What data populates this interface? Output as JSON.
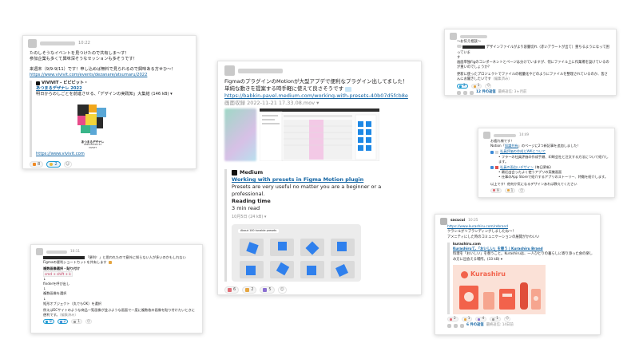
{
  "c1": {
    "time": "10:22",
    "line1": "たのしそうなイベントを見つけたので共有しま〜す！",
    "line2": "参加企業も多くて興味深そうなセッションも多そうです！",
    "line3": "来週末（9/9-9/11）です！申し込めば無料で見られるので興味ある方せひ〜！",
    "url": "https://www.vivivit.com/events/dezanare/atsumaru/2022",
    "unfurl_site": "VIVIVIT - ビビビット・",
    "unfurl_title": "あつまるデザナレ 2022",
    "unfurl_desc": "明日からのしごとを前進させる、「デザインの実践知」大集結 (146 kB) ▾",
    "poster_title": "あつまるデザナレ",
    "poster_date": "2022.09.09-11",
    "poster_brand": "VIVIVIT",
    "unfurl_link": "https://www.vivivit.com",
    "react_a": "8",
    "react_b": "2"
  },
  "c2": {
    "line1": "FigmaのプラグインのMotionが大型アプデで便利なプラグイン出してました！",
    "line2": "単純な動きを提案する時手軽に使えて良さそうです",
    "url": "https://babkin-pavel.medium.com/working-with-presets-40b07d5fcb8e",
    "file": "画面収録 2022-11-21 17.33.08.mov ▾",
    "medium_label": "Medium",
    "article_title": "Working with presets in Figma Motion plugin",
    "article_desc": "Presets are very useful no matter you are a beginner or a professional.",
    "read_label": "Reading time",
    "read_value": "3 min read",
    "date_meta": "10月5日 (24 kB) ▾",
    "preview_label": "About 100 tunable presets",
    "react_a": "6",
    "react_b": "2",
    "react_c": "5"
  },
  "c3": {
    "line1": "〜お伝え相談〜",
    "line2": "デザインファイルがより容量切れ（赤いアラートが出て）重ちるようになって困っていま",
    "line2b": "す",
    "line3": "画面単独Figのコンポーネントとページは分けていますが、何にファイル上に作業場を設けているのが重いのでしょうか？",
    "line4": "更新に使ったプロジェクトでファイルの軽量化やどのようにファイルを整理されているのか、皆さんにお聞きしたいです",
    "edited": "（編集済み）",
    "react_a": "2",
    "react_b": "1",
    "thread": "12 件の返信",
    "thread_time": "最終返信: 3ヶ月前"
  },
  "c4": {
    "time": "14:49",
    "line1": "お疲れ様です！",
    "line2a": "Notion「",
    "line2link": "知識共有",
    "line2b": "」のページに2つ新記事を追加しました！",
    "item1_link": "社員評価の作成とWKについて",
    "item1_sub": "フラーの社員評価の作成手順、印刷会社と注文する方法について紹介します。",
    "item2_link": "社員の面白いデザイン",
    "item2_tag": "(毎日更新)",
    "item2_sub1": "最近出会ったよく使うアプリの実機画面",
    "item2_sub2": "仕事のApp Storeで紹介するアプリのストーリー、特徴を紹介します。",
    "closing": "以上です！他何か気になるデザインあれば教えてください",
    "react_a": "9",
    "react_b": "1"
  },
  "c5": {
    "time": "10:11",
    "line1": "「便利！」と思われたので意外に知らない人が多いのかもしれない",
    "line2": "Figmaの便利ショートカットを共有します",
    "section": "複数画像選択・貼り付け",
    "code1": "cmd + shift + k",
    "arrow1": "↓",
    "step1": "finderを呼び出し",
    "arrow2": "↓",
    "step2": "複数画像を選択",
    "arrow3": "↓",
    "step3": "矩形オブジェクト（丸でもOK）を選択",
    "note": "例えばECサイトのような商品一覧画像が並ぶような画面で一度に複数枚の画像を貼り付けたいときに便利です。",
    "edited": "（編集済み）",
    "react_a": "9",
    "react_b": "2",
    "react_c": "1"
  },
  "c6": {
    "name": "sacucui",
    "time": "10:25",
    "url": "https://www.kurashiru.com/rebrand",
    "line1": "クラシルがリブランディングしましたね〜！",
    "line2": "アメニティにした時のコミュニケーションの展開がかわいい",
    "unfurl_site": "kurashiru.com",
    "unfurl_title": "Kurashiruて、「おいしい」を替う | Kurashiru Brand",
    "unfurl_desc": "料理を「おいしい」を替うこと。Kurashiruは、一人ひとりの暮らしに寄り添った食の楽しみ方に出会える場所。(33 kB) ▾",
    "brand_name": "Kurashiru",
    "react_a": "2",
    "react_b": "1",
    "react_c": "4",
    "react_d": "1",
    "thread": "6 件の返信",
    "thread_time": "最終返信: 14日前"
  },
  "colors": {
    "link": "#1264a3",
    "kurashiru": "#f2624b",
    "figma_blue": "#1e88e5"
  }
}
